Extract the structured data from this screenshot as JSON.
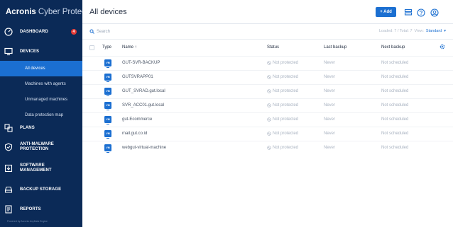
{
  "brand": {
    "name_bold": "Acronis",
    "name_light": "Cyber Protect"
  },
  "nav": [
    {
      "label": "DASHBOARD",
      "icon": "gauge-icon",
      "badge": "4"
    },
    {
      "label": "DEVICES",
      "icon": "monitor-icon"
    },
    {
      "label": "PLANS",
      "icon": "plans-icon"
    },
    {
      "label": "ANTI-MALWARE PROTECTION",
      "icon": "shield-icon"
    },
    {
      "label": "SOFTWARE MANAGEMENT",
      "icon": "software-icon"
    },
    {
      "label": "BACKUP STORAGE",
      "icon": "storage-icon"
    },
    {
      "label": "REPORTS",
      "icon": "reports-icon"
    }
  ],
  "device_subitems": [
    "All devices",
    "Machines with agents",
    "Unmanaged machines",
    "Data protection map"
  ],
  "footer": "Powered by Acronis AnyData Engine",
  "header": {
    "title": "All devices",
    "add_label": "+ Add"
  },
  "toolbar": {
    "search_placeholder": "Search",
    "loaded": "Loaded: 7 / Total: 7",
    "view_label": "View:",
    "view_value": "Standard"
  },
  "table": {
    "columns": {
      "type": "Type",
      "name": "Name ↑",
      "status": "Status",
      "last_backup": "Last backup",
      "next_backup": "Next backup"
    },
    "rows": [
      {
        "type": "VM",
        "name": "GUT-SVR-BACKUP",
        "status": "Not protected",
        "last_backup": "Never",
        "next_backup": "Not scheduled"
      },
      {
        "type": "VM",
        "name": "GUTSVRAPP01",
        "status": "Not protected",
        "last_backup": "Never",
        "next_backup": "Not scheduled"
      },
      {
        "type": "VM",
        "name": "GUT_SVRAD.gut.local",
        "status": "Not protected",
        "last_backup": "Never",
        "next_backup": "Not scheduled"
      },
      {
        "type": "VM",
        "name": "SVR_ACC01.gut.local",
        "status": "Not protected",
        "last_backup": "Never",
        "next_backup": "Not scheduled"
      },
      {
        "type": "VM",
        "name": "gut-Ecommerce",
        "status": "Not protected",
        "last_backup": "Never",
        "next_backup": "Not scheduled"
      },
      {
        "type": "VM",
        "name": "mail.gut.co.id",
        "status": "Not protected",
        "last_backup": "Never",
        "next_backup": "Not scheduled"
      },
      {
        "type": "VM",
        "name": "webgut-virtual-machine",
        "status": "Not protected",
        "last_backup": "Never",
        "next_backup": "Not scheduled"
      }
    ]
  },
  "colors": {
    "sidebar": "#0b2a57",
    "accent": "#1b6fd1",
    "badge": "#e53935"
  }
}
